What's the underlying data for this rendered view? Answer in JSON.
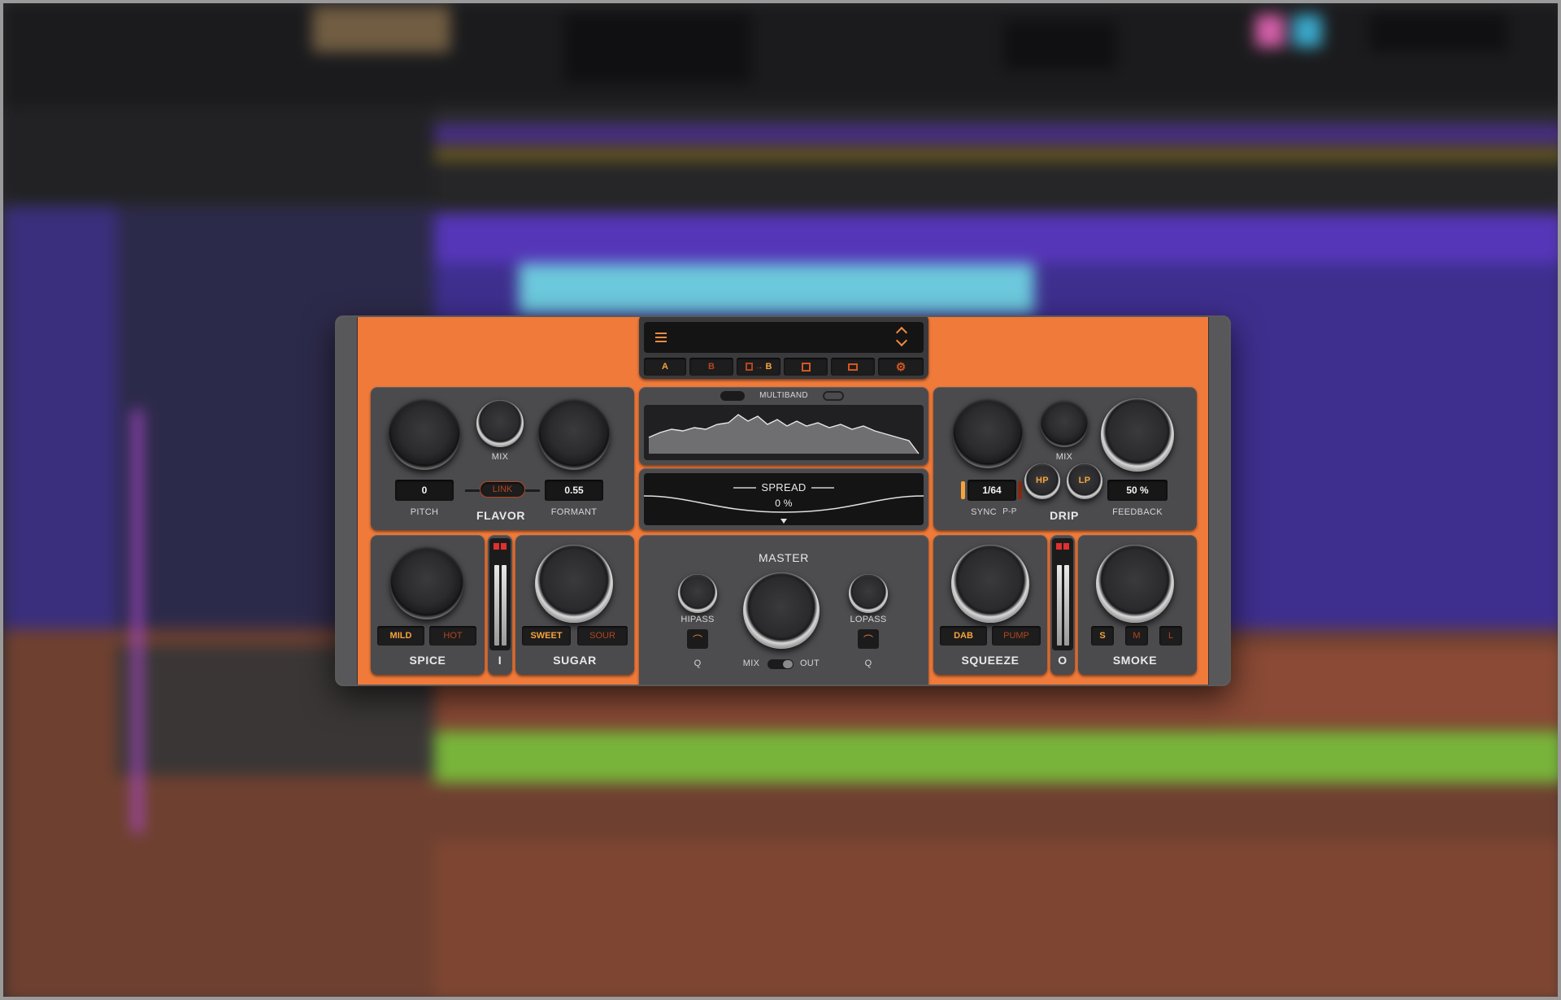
{
  "plugin": {
    "preset_menu_icon": "hamburger-icon",
    "preset_name": "",
    "ab": {
      "a": "A",
      "b": "B",
      "copy_b": "B"
    },
    "flavor": {
      "title": "FLAVOR",
      "mix_label": "MIX",
      "pitch_label": "PITCH",
      "pitch_value": "0",
      "link_label": "LINK",
      "formant_label": "FORMANT",
      "formant_value": "0.55"
    },
    "multiband": {
      "label": "MULTIBAND"
    },
    "spread": {
      "label": "SPREAD",
      "value": "0 %"
    },
    "drip": {
      "title": "DRIP",
      "mix_label": "MIX",
      "sync_value": "1/64",
      "sync_label": "SYNC",
      "pp_label": "P-P",
      "hp_label": "HP",
      "lp_label": "LP",
      "feedback_label": "FEEDBACK",
      "feedback_value": "50 %"
    },
    "spice": {
      "title": "SPICE",
      "mild": "MILD",
      "hot": "HOT"
    },
    "input_meter": {
      "label": "I",
      "level": 0.85
    },
    "sugar": {
      "title": "SUGAR",
      "sweet": "SWEET",
      "sour": "SOUR"
    },
    "master": {
      "title": "MASTER",
      "hipass_label": "HIPASS",
      "lopass_label": "LOPASS",
      "q_label_left": "Q",
      "q_label_right": "Q",
      "mix_label": "MIX",
      "out_label": "OUT"
    },
    "squeeze": {
      "title": "SQUEEZE",
      "dab": "DAB",
      "pump": "PUMP"
    },
    "output_meter": {
      "label": "O",
      "level": 0.85
    },
    "smoke": {
      "title": "SMOKE",
      "s": "S",
      "m": "M",
      "l": "L"
    }
  }
}
